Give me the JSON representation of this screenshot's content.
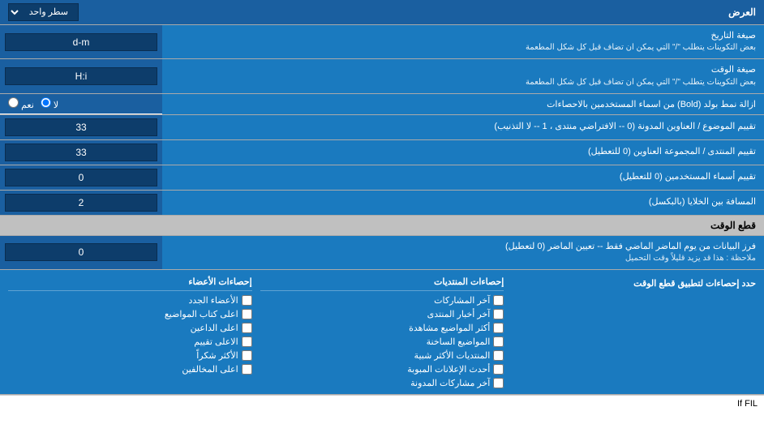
{
  "header": {
    "label": "العرض",
    "dropdown_label": "سطر واحد"
  },
  "rows": [
    {
      "id": "date_format",
      "label": "صيغة التاريخ",
      "sublabel": "بعض التكوينات يتطلب \"/\" التي يمكن ان تضاف قبل كل شكل المطعمة",
      "value": "d-m"
    },
    {
      "id": "time_format",
      "label": "صيغة الوقت",
      "sublabel": "بعض التكوينات يتطلب \"/\" التي يمكن ان تضاف قبل كل شكل المطعمة",
      "value": "H:i"
    }
  ],
  "radio_row": {
    "label": "ازالة نمط بولد (Bold) من اسماء المستخدمين بالاحصاءات",
    "option_yes": "نعم",
    "option_no": "لا",
    "selected": "no"
  },
  "rows2": [
    {
      "id": "topics_headers",
      "label": "تقييم الموضوع / العناوين المدونة (0 -- الافتراضي منتدى ، 1 -- لا التذنيب)",
      "value": "33"
    },
    {
      "id": "forum_headers",
      "label": "تقييم المنتدى / المجموعة العناوين (0 للتعطيل)",
      "value": "33"
    },
    {
      "id": "usernames",
      "label": "تقييم أسماء المستخدمين (0 للتعطيل)",
      "value": "0"
    },
    {
      "id": "cells_distance",
      "label": "المسافة بين الخلايا (بالبكسل)",
      "value": "2"
    }
  ],
  "section_realtime": {
    "title": "قطع الوقت"
  },
  "row_realtime": {
    "label": "فرز البيانات من يوم الماضر الماضي فقط -- تعيين الماضر (0 لتعطيل)",
    "note": "ملاحظة : هذا قد يزيد قليلاً وقت التحميل",
    "value": "0"
  },
  "checkboxes_section": {
    "header": "حدد إحصاءات لتطبيق قطع الوقت",
    "col1_header": "إحصاءات المنتديات",
    "col1_items": [
      "آخر المشاركات",
      "آخر أخبار المنتدى",
      "أكثر المواضيع مشاهدة",
      "المواضيع الساخنة",
      "المنتديات الأكثر شبية",
      "أحدث الإعلانات المبوبة",
      "آخر مشاركات المدونة"
    ],
    "col2_header": "إحصاءات الأعضاء",
    "col2_items": [
      "الأعضاء الجدد",
      "اعلى كتاب المواضيع",
      "اعلى الداعين",
      "الاعلى تقييم",
      "الأكثر شكراً",
      "اعلى المخالفين"
    ]
  },
  "footer_text": "If FIL"
}
